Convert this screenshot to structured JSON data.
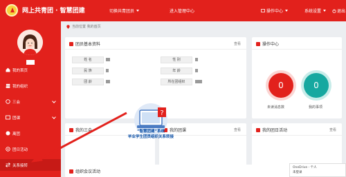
{
  "header": {
    "brand": "网上共青团 · 智慧团建",
    "nav_switch": "切换共青团员",
    "nav_manage": "进入管理中心",
    "mail_label": "操作中心",
    "settings_label": "系统设置",
    "logout_label": "退出"
  },
  "sidebar": {
    "items": [
      {
        "label": "我的首页",
        "icon": "home-icon"
      },
      {
        "label": "我的组织",
        "icon": "group-icon"
      },
      {
        "label": "三会",
        "icon": "meeting-icon"
      },
      {
        "label": "团课",
        "icon": "lesson-icon"
      },
      {
        "label": "离团",
        "icon": "leave-icon"
      },
      {
        "label": "团日活动",
        "icon": "activity-icon"
      },
      {
        "label": "关系接转",
        "icon": "transfer-icon"
      }
    ]
  },
  "breadcrumb": "当前位置 我的首页",
  "cards": {
    "member_info": {
      "title": "团员基本资料",
      "more": "查看",
      "labels": [
        "姓  名",
        "民  族",
        "团  龄",
        "性  别",
        "年  龄",
        "所在团组织"
      ]
    },
    "ops": {
      "title": "操作中心",
      "pending_count": "0",
      "todo_count": "0",
      "pending_label": "未读消息数",
      "todo_label": "我的事项"
    },
    "three_meetings": {
      "title": "我的三会",
      "more": "查看"
    },
    "lessons": {
      "title": "我的团课",
      "more": "查看"
    },
    "activities": {
      "title": "我的团日活动",
      "more": "查看"
    },
    "org_meetings": {
      "title": "组织会议活动"
    }
  },
  "promo": {
    "line1": "“智慧团建”系统",
    "line2": "毕业学生团员组织关系转接"
  },
  "popup": {
    "line1": "OneDrive - 个人",
    "line2": "未登录"
  },
  "colors": {
    "brand_red": "#e2211c",
    "pending_green": "#17a8a0"
  }
}
